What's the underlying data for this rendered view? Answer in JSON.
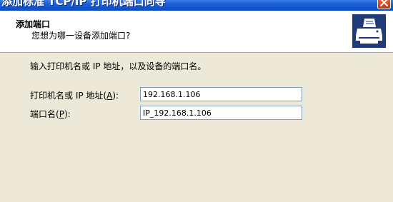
{
  "window": {
    "title": "添加标准 TCP/IP 打印机端口向导"
  },
  "header": {
    "title": "添加端口",
    "subtitle": "您想为哪一设备添加端口?",
    "icon": "printer-icon"
  },
  "body": {
    "instruction": "输入打印机名或 IP 地址，以及设备的端口名。",
    "fields": [
      {
        "label_prefix": "打印机名或 IP 地址(",
        "accesskey": "A",
        "label_suffix": "):",
        "value": "192.168.1.106"
      },
      {
        "label_prefix": "端口名(",
        "accesskey": "P",
        "label_suffix": "):",
        "value": "IP_192.168.1.106"
      }
    ]
  }
}
